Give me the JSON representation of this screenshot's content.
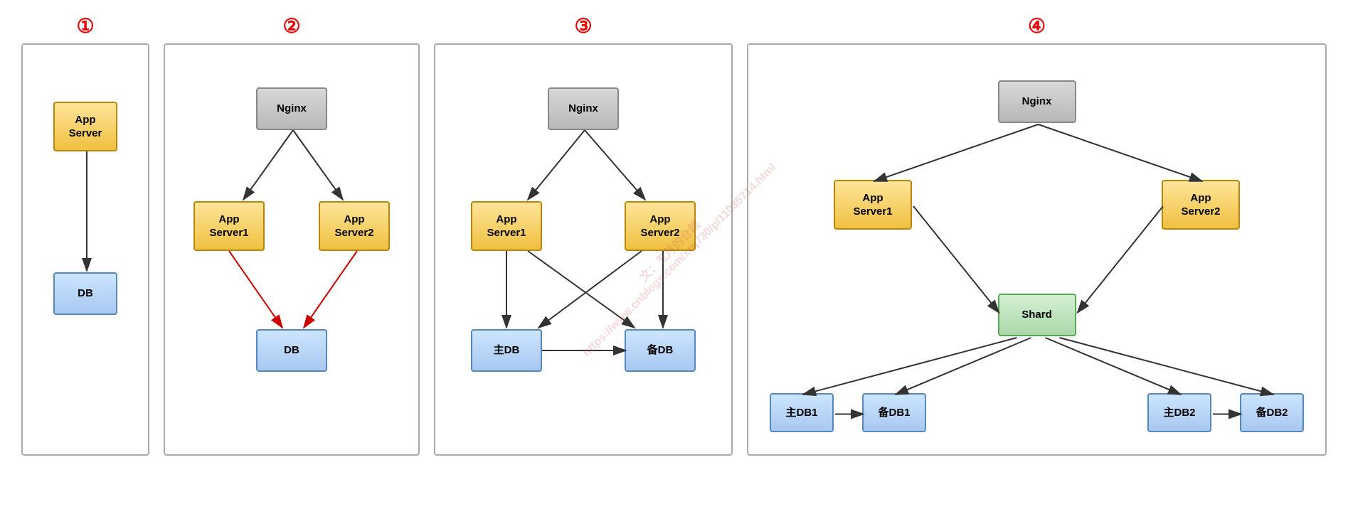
{
  "diagrams": [
    {
      "id": "diagram1",
      "label": "①",
      "nodes": {
        "app_server": "App\nServer",
        "db": "DB"
      }
    },
    {
      "id": "diagram2",
      "label": "②",
      "nodes": {
        "nginx": "Nginx",
        "app_server1": "App\nServer1",
        "app_server2": "App\nServer2",
        "db": "DB"
      }
    },
    {
      "id": "diagram3",
      "label": "③",
      "nodes": {
        "nginx": "Nginx",
        "app_server1": "App\nServer1",
        "app_server2": "App\nServer2",
        "master_db": "主DB",
        "backup_db": "备DB"
      }
    },
    {
      "id": "diagram4",
      "label": "④",
      "nodes": {
        "nginx": "Nginx",
        "app_server1": "App\nServer1",
        "app_server2": "App\nServer2",
        "shard": "Shard",
        "master_db1": "主DB1",
        "backup_db1": "备DB1",
        "master_db2": "主DB2",
        "backup_db2": "备DB2"
      }
    }
  ],
  "watermark": {
    "line1": "文：五月的仓颉",
    "line2": "https://www.cnblogs.com/xrq730/p/11035714.html"
  }
}
